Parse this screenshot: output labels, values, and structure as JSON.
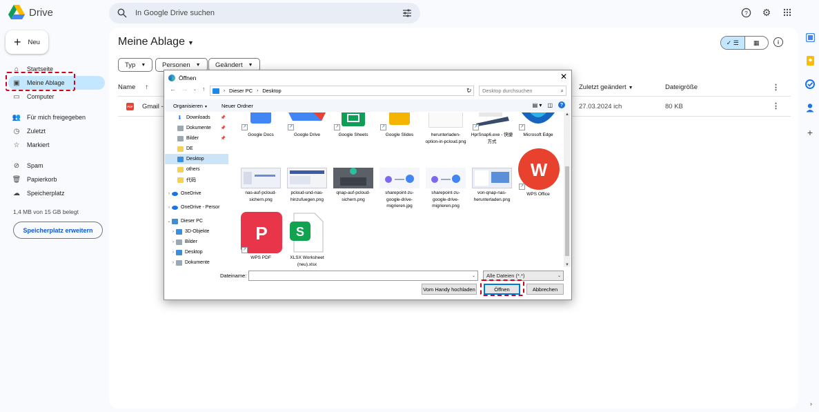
{
  "app": {
    "name": "Drive"
  },
  "search": {
    "placeholder": "In Google Drive suchen"
  },
  "new_button": {
    "label": "Neu"
  },
  "sidebar": {
    "items": [
      {
        "label": "Startseite",
        "icon": "home-icon"
      },
      {
        "label": "Meine Ablage",
        "icon": "my-drive-icon",
        "active": true
      },
      {
        "label": "Computer",
        "icon": "computer-icon"
      },
      {
        "label": "Für mich freigegeben",
        "icon": "shared-icon"
      },
      {
        "label": "Zuletzt",
        "icon": "clock-icon"
      },
      {
        "label": "Markiert",
        "icon": "star-icon"
      },
      {
        "label": "Spam",
        "icon": "spam-icon"
      },
      {
        "label": "Papierkorb",
        "icon": "trash-icon"
      },
      {
        "label": "Speicherplatz",
        "icon": "cloud-icon"
      }
    ],
    "storage_text": "1,4 MB von 15 GB belegt",
    "storage_button": "Speicherplatz erweitern"
  },
  "main": {
    "title": "Meine Ablage",
    "filters": [
      "Typ",
      "Personen",
      "Geändert"
    ],
    "columns": {
      "name": "Name",
      "modified": "Zuletzt geändert",
      "size": "Dateigröße"
    },
    "rows": [
      {
        "name": "Gmail -",
        "modified": "27.03.2024 ich",
        "size": "80 KB"
      }
    ]
  },
  "dialog": {
    "title": "Öffnen",
    "breadcrumb": [
      "Dieser PC",
      "Desktop"
    ],
    "search_placeholder": "Desktop durchsuchen",
    "toolbar": {
      "organize": "Organisieren",
      "new_folder": "Neuer Ordner"
    },
    "tree": [
      {
        "label": "Downloads",
        "icon": "download",
        "pinned": true
      },
      {
        "label": "Dokumente",
        "icon": "doc",
        "pinned": true
      },
      {
        "label": "Bilder",
        "icon": "pic",
        "pinned": true
      },
      {
        "label": "DE",
        "icon": "folder"
      },
      {
        "label": "Desktop",
        "icon": "desktop",
        "selected": true
      },
      {
        "label": "others",
        "icon": "folder"
      },
      {
        "label": "代码",
        "icon": "folder"
      },
      {
        "label": "OneDrive",
        "icon": "cloud",
        "expandable": true
      },
      {
        "label": "OneDrive - Persor",
        "icon": "cloud",
        "expandable": true
      },
      {
        "label": "Dieser PC",
        "icon": "pc",
        "expanded": true
      },
      {
        "label": "3D-Objekte",
        "icon": "folder3d",
        "expandable": true
      },
      {
        "label": "Bilder",
        "icon": "pic",
        "expandable": true
      },
      {
        "label": "Desktop",
        "icon": "desktop",
        "expandable": true
      },
      {
        "label": "Dokumente",
        "icon": "doc",
        "expandable": true
      }
    ],
    "files": [
      {
        "label": "Google Docs",
        "kind": "gdocs"
      },
      {
        "label": "Google Drive",
        "kind": "gdrive"
      },
      {
        "label": "Google Sheets",
        "kind": "gsheets"
      },
      {
        "label": "Google Slides",
        "kind": "gslides"
      },
      {
        "label": "herunterladen-option-in-pcloud.png",
        "kind": "png"
      },
      {
        "label": "HprSnap6.exe - 快捷方式",
        "kind": "exe"
      },
      {
        "label": "Microsoft Edge",
        "kind": "edge"
      },
      {
        "label": "nas-auf-pcloud-sichern.png",
        "kind": "png"
      },
      {
        "label": "pcloud-und-nas-hinzufuegen.png",
        "kind": "png"
      },
      {
        "label": "qnap-auf-pcloud-sichern.png",
        "kind": "png"
      },
      {
        "label": "sharepoint-zu-google-drive-migrieren.jpg",
        "kind": "jpg"
      },
      {
        "label": "sharepoint-zu-google-drive-migrieren.png",
        "kind": "png"
      },
      {
        "label": "von-qnap-nas-herunterladen.png",
        "kind": "png"
      },
      {
        "label": "WPS Office",
        "kind": "wps"
      },
      {
        "label": "WPS PDF",
        "kind": "wpspdf"
      },
      {
        "label": "XLSX Worksheet (neu).xlsx",
        "kind": "xlsx"
      }
    ],
    "filename_label": "Dateiname:",
    "filename_value": "",
    "filetype": "Alle Dateien (*.*)",
    "buttons": {
      "phone": "Vom Handy hochladen",
      "open": "Öffnen",
      "cancel": "Abbrechen"
    }
  },
  "colors": {
    "accent": "#0b57d0",
    "active_nav": "#c2e7ff",
    "highlight": "#d0021b"
  }
}
